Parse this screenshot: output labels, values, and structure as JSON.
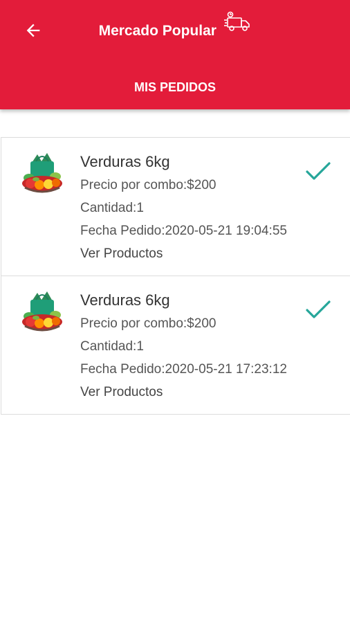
{
  "header": {
    "title": "Mercado Popular",
    "tab_label": "MIS PEDIDOS",
    "background_color": "#e31c3a"
  },
  "icons": {
    "back": "arrow-left-icon",
    "logo": "delivery-truck-icon",
    "status": "checkmark-icon",
    "product": "vegetable-basket-icon"
  },
  "accent_color": "#26a69a",
  "orders": [
    {
      "name": "Verduras 6kg",
      "price": "Precio por combo:$200",
      "quantity": "Cantidad:1",
      "date": "Fecha Pedido:2020-05-21 19:04:55",
      "link": "Ver Productos"
    },
    {
      "name": "Verduras 6kg",
      "price": "Precio por combo:$200",
      "quantity": "Cantidad:1",
      "date": "Fecha Pedido:2020-05-21 17:23:12",
      "link": "Ver Productos"
    }
  ]
}
